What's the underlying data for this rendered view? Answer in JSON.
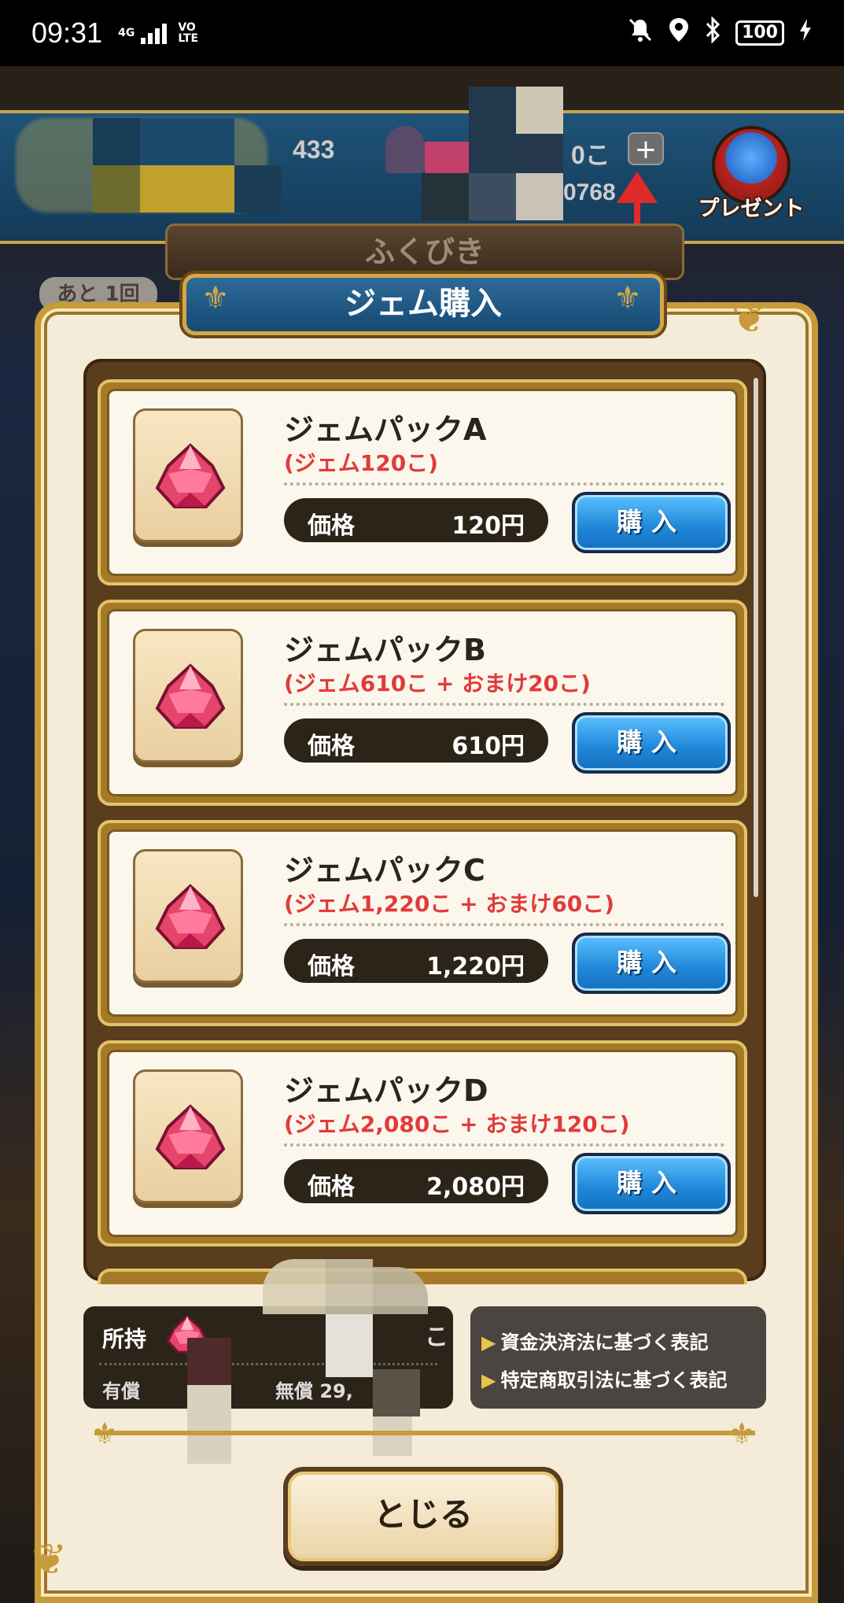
{
  "status_bar": {
    "time": "09:31",
    "network": "4G",
    "volte_top": "VO",
    "volte_bottom": "LTE",
    "battery": "100",
    "icons": [
      "mute-icon",
      "location-icon",
      "bluetooth-icon",
      "battery-icon",
      "charging-icon"
    ]
  },
  "topbar": {
    "value_left_partial": "433",
    "value_right_partial": "0こ",
    "value_second_row_partial": "0768",
    "plus_label": "+",
    "present_label": "プレゼント"
  },
  "background": {
    "fukubiki_label": "ふくびき",
    "remaining_badge": "あと 1回"
  },
  "dialog": {
    "title": "ジェム購入",
    "packs": [
      {
        "name": "ジェムパックA",
        "contents": "(ジェム120こ)",
        "price_label": "価格",
        "price": "120円",
        "buy_label": "購入"
      },
      {
        "name": "ジェムパックB",
        "contents": "(ジェム610こ + おまけ20こ)",
        "price_label": "価格",
        "price": "610円",
        "buy_label": "購入"
      },
      {
        "name": "ジェムパックC",
        "contents": "(ジェム1,220こ + おまけ60こ)",
        "price_label": "価格",
        "price": "1,220円",
        "buy_label": "購入"
      },
      {
        "name": "ジェムパックD",
        "contents": "(ジェム2,080こ + おまけ120こ)",
        "price_label": "価格",
        "price": "2,080円",
        "buy_label": "購入"
      }
    ],
    "owned": {
      "label": "所持",
      "unit": "こ",
      "paid_label": "有償",
      "free_label": "無償 29,"
    },
    "legal_links": [
      "資金決済法に基づく表記",
      "特定商取引法に基づく表記"
    ],
    "close_label": "とじる"
  },
  "colors": {
    "accent_gold": "#c79a3a",
    "panel_cream": "#f4ecd9",
    "buy_blue": "#1f86d8",
    "price_red": "#e23a3a",
    "title_blue": "#154a73",
    "annotation_arrow": "#e02a2a"
  }
}
